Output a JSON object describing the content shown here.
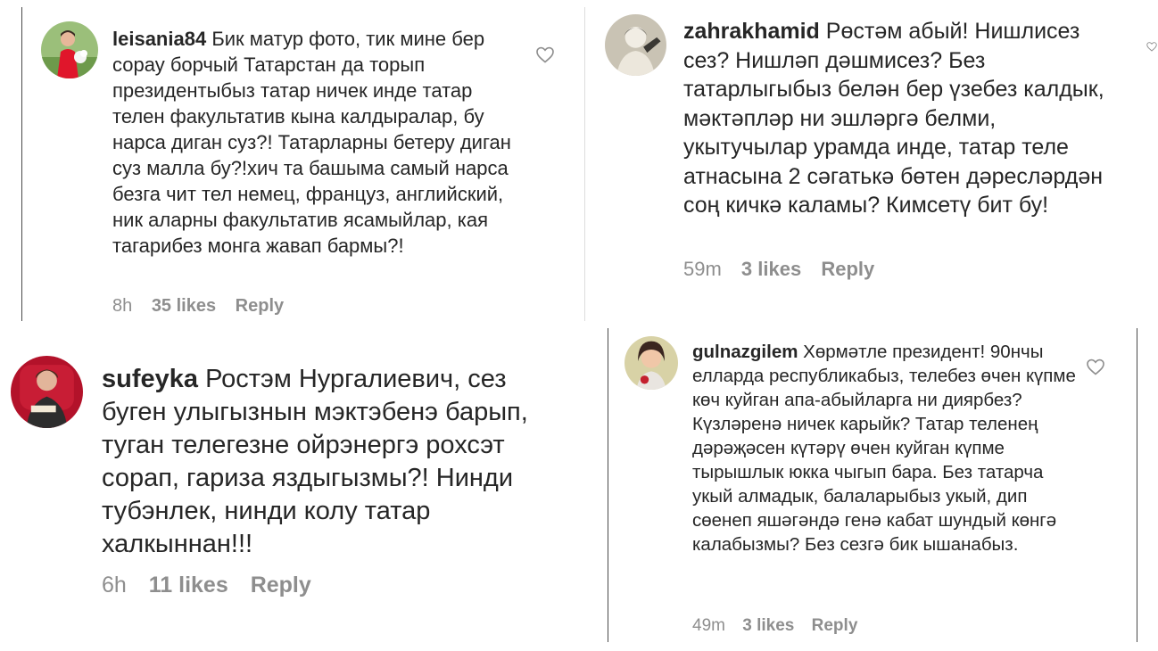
{
  "comments": [
    {
      "username": "leisania84",
      "text": "Бик матур фото, тик мине бер сорау борчый Татарстан да торып президентыбыз татар ничек инде татар телен факультатив кына калдыралар, бу нарса диган суз?! Татарларны бетеру диган суз малла бу?!хич та башыма самый нарса безга чит тел немец, француз, английский, ник аларны факультатив ясамыйлар, кая тагарибез монга жавап бармы?!",
      "time": "8h",
      "likes": "35 likes",
      "reply": "Reply",
      "avatar_icon": "user-avatar-red-dress-flowers"
    },
    {
      "username": "zahrakhamid",
      "text": "Рөстәм абый! Нишлисез сез? Нишләп дәшмисез? Без татарлыгыбыз белән бер үзебез калдык, мәктәпләр ни эшләргә белми, укытучылар урамда инде, татар теле атнасына 2 сәгатькә бөтен дәресләрдән соң кичкә каламы? Кимсетү бит бу!",
      "time": "59m",
      "likes": "3 likes",
      "reply": "Reply",
      "avatar_icon": "user-avatar-sketch"
    },
    {
      "username": "sufeyka",
      "text": "Ростэм Нургалиевич, сез буген улыгызнын мэктэбенэ барып, туган телегезне ойрэнергэ рохсэт сорап, гариза яздыгызмы?! Нинди тубэнлек, нинди колу татар халкыннан!!!",
      "time": "6h",
      "likes": "11 likes",
      "reply": "Reply",
      "avatar_icon": "user-avatar-red-chair"
    },
    {
      "username": "gulnazgilem",
      "text": "Хөрмәтле президент! 90нчы елларда республикабыз, телебез өчен күпме көч куйган апа-абыйларга ни диярбез? Күзләренә ничек карыйк? Татар теленең дәрәҗәсен күтәрү өчен куйган күпме тырышлык юкка чыгып бара. Без татарча укый алмадык, балаларыбыз укый, дип сөенеп яшәгәндә генә кабат шундый көнгә калабызмы? Без сезгә бик ышанабыз.",
      "time": "49m",
      "likes": "3 likes",
      "reply": "Reply",
      "avatar_icon": "user-avatar-woman-smiling"
    }
  ],
  "icons": {
    "like": "heart-outline-icon"
  },
  "colors": {
    "text": "#262626",
    "meta": "#8e8e8e",
    "divider": "#4a4a4a"
  }
}
